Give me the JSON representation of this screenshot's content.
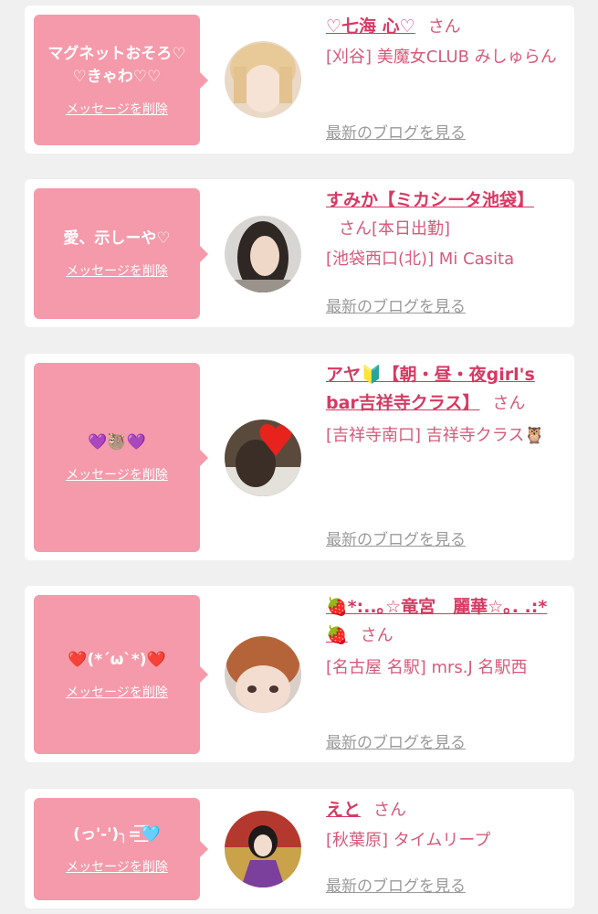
{
  "entries": [
    {
      "message": "マグネットおそろ♡♡きゃわ♡♡",
      "delete_label": "メッセージを削除",
      "name": "♡七海 心♡",
      "honorific": "さん",
      "shop": "[刈谷] 美魔女CLUB みしゅらん",
      "blog_label": "最新のブログを見る"
    },
    {
      "message": "愛、示しーや♡",
      "delete_label": "メッセージを削除",
      "name": "すみか【ミカシータ池袋】",
      "honorific": "さん",
      "status": "[本日出勤]",
      "shop": "[池袋西口(北)] Mi Casita",
      "blog_label": "最新のブログを見る"
    },
    {
      "message": "💜🦥💜",
      "delete_label": "メッセージを削除",
      "name": "アヤ🔰【朝・昼・夜girl's bar吉祥寺クラス】",
      "honorific": "さん",
      "shop": "[吉祥寺南口] 吉祥寺クラス🦉",
      "blog_label": "最新のブログを見る"
    },
    {
      "message": "❤️(*´ω`*)❤️",
      "delete_label": "メッセージを削除",
      "name": "🍓*:..｡☆竜宮　麗華☆｡. .:*🍓",
      "honorific": "さん",
      "shop": "[名古屋 名駅] mrs.J 名駅西",
      "blog_label": "最新のブログを見る"
    },
    {
      "message": "(っ'-')╮=͟͟͞͞🩵",
      "delete_label": "メッセージを削除",
      "name": "えと",
      "honorific": "さん",
      "shop": "[秋葉原] タイムリープ",
      "blog_label": "最新のブログを見る"
    }
  ],
  "colors": {
    "bubble": "#f59aaa",
    "name": "#d63a63",
    "text": "#d65a7a",
    "link_gray": "#9a9a9a",
    "background": "#f1f0f0"
  }
}
